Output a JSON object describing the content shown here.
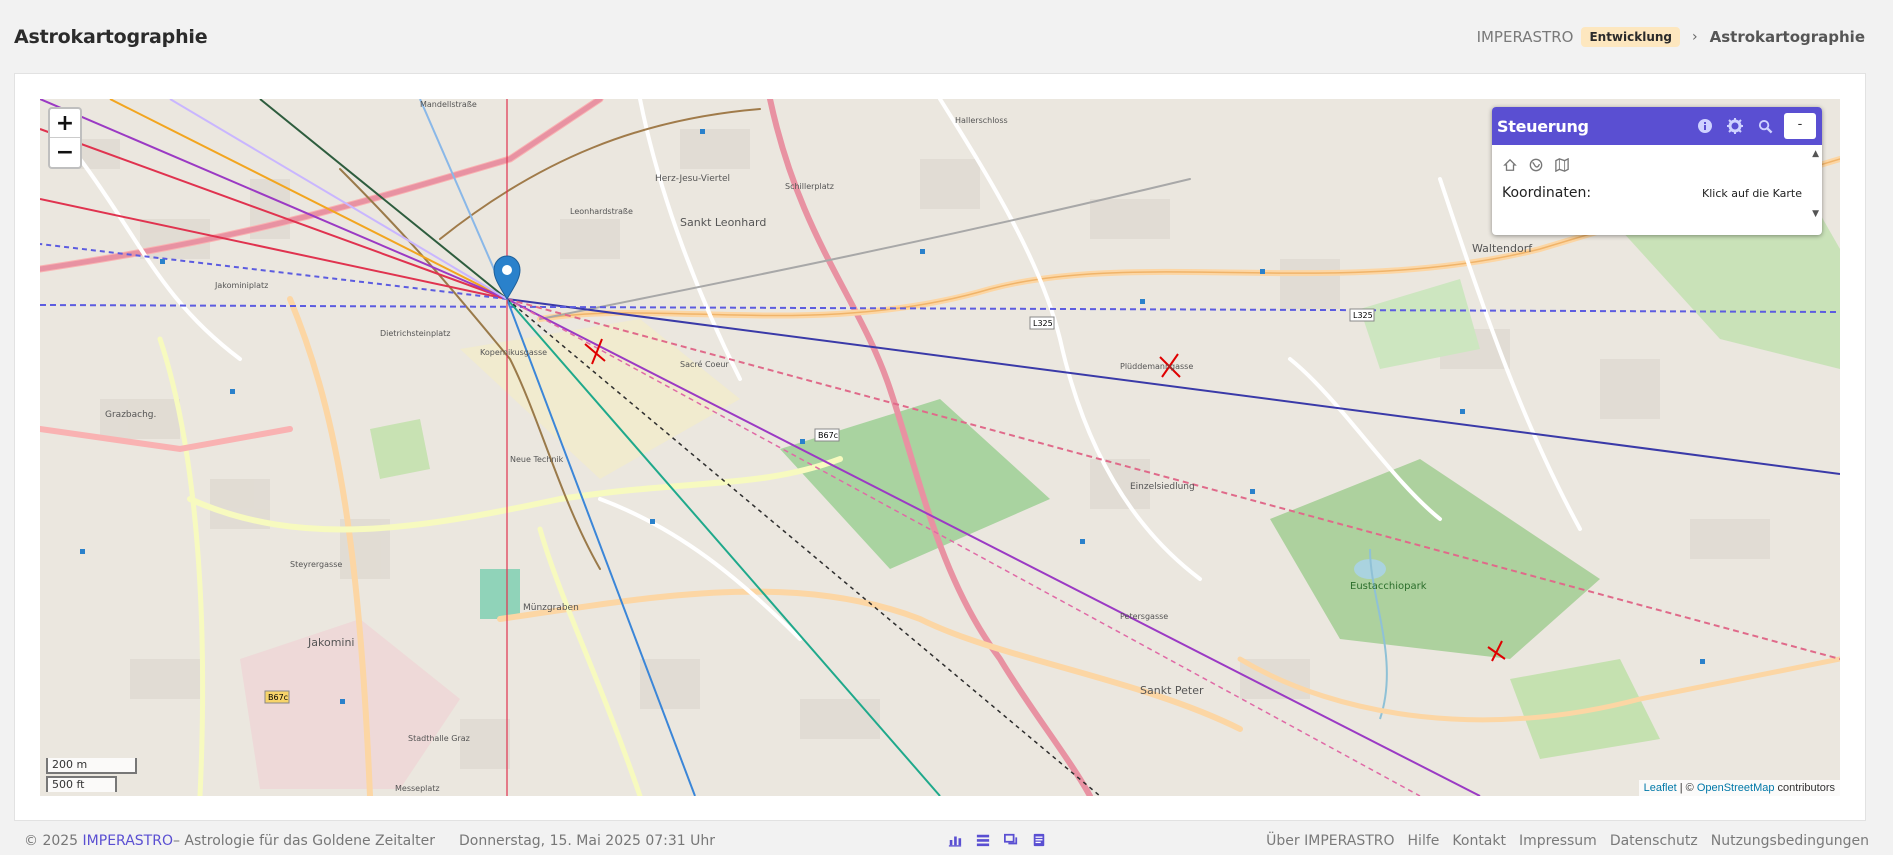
{
  "header": {
    "title": "Astrokartographie",
    "breadcrumb": {
      "home": "IMPERASTRO",
      "badge": "Entwicklung",
      "separator": "›",
      "current": "Astrokartographie"
    }
  },
  "map": {
    "zoom_in": "+",
    "zoom_out": "−",
    "scale_metric": "200 m",
    "scale_imperial": "500 ft",
    "attribution": {
      "leaflet": "Leaflet",
      "sep": " | © ",
      "osm": "OpenStreetMap",
      "suffix": " contributors"
    },
    "place_labels": [
      "Sankt Leonhard",
      "Herz-Jesu-Viertel",
      "Waltendorf",
      "Jakomini",
      "Sankt Peter",
      "Eustacchiopark",
      "Jakominiplatz",
      "Dietrichsteinplatz",
      "Münzgraben",
      "Einzelsiedlung",
      "Grazbachg.",
      "Stadthalle Graz",
      "Messeplatz",
      "Mandellstraße",
      "Schillerplatz",
      "Hallerschloss",
      "L325",
      "B67c",
      "Neue Technik",
      "Steyrergasse",
      "Petersgasse",
      "Sacré Coeur",
      "Kopernikusgasse",
      "Leonhardstraße",
      "Plüddemanngasse"
    ],
    "colors": {
      "line_red": "#e0334f",
      "line_blue": "#3a3aa8",
      "line_purple": "#9b3ac4",
      "line_teal": "#1fa98b",
      "line_orange": "#f2a51f",
      "line_green": "#2e7d32",
      "line_lightblue": "#3b86d8",
      "line_pink": "#e06aa6",
      "marker": "#2a81cb"
    }
  },
  "panel": {
    "title": "Steuerung",
    "info_icon": "info-icon",
    "settings_icon": "gear-icon",
    "search_icon": "search-icon",
    "collapse_label": "-",
    "tools": [
      "home-icon",
      "globe-icon",
      "map-icon"
    ],
    "coords_label": "Koordinaten:",
    "coords_value": "Klick auf die Karte"
  },
  "footer": {
    "copyright_prefix": "© 2025",
    "brand": "IMPERASTRO",
    "tagline": "– Astrologie für das Goldene Zeitalter",
    "datetime": "Donnerstag,  15. Mai 2025 07:31 Uhr",
    "icons": [
      "chart-icon",
      "layers-icon",
      "chat-icon",
      "book-icon"
    ],
    "links": [
      "Über IMPERASTRO",
      "Hilfe",
      "Kontakt",
      "Impressum",
      "Datenschutz",
      "Nutzungsbedingungen"
    ]
  }
}
